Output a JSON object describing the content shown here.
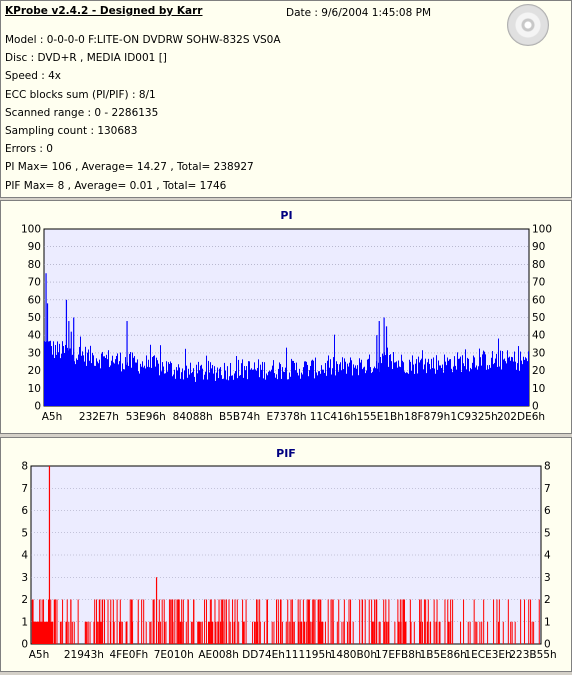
{
  "header": {
    "title": "KProbe v2.4.2 - Designed by Karr",
    "date": "Date : 9/6/2004 1:45:08 PM",
    "lines": [
      "Model : 0-0-0-0 F:LITE-ON DVDRW SOHW-832S  VS0A",
      "Disc : DVD+R , MEDIA ID001 []",
      "Speed : 4x",
      "ECC blocks sum (PI/PIF) : 8/1",
      "Scanned range : 0 - 2286135",
      "Sampling count : 130683",
      "Errors : 0",
      "PI Max= 106 , Average= 14.27 , Total= 238927",
      "PIF Max= 8 , Average= 0.01 , Total= 1746"
    ]
  },
  "chart_data": [
    {
      "type": "bar",
      "title": "PI",
      "ylim": [
        0,
        100
      ],
      "yticks": [
        0,
        10,
        20,
        30,
        40,
        50,
        60,
        70,
        80,
        90,
        100
      ],
      "xtick_labels": [
        "A5h",
        "232E7h",
        "53E96h",
        "84088h",
        "B5B74h",
        "E7378h",
        "11C416h",
        "155E1Bh",
        "18F879h",
        "1C9325h",
        "202DE6h"
      ],
      "color": "#0000ff",
      "profile_x": [
        0,
        0.01,
        0.02,
        0.04,
        0.06,
        0.1,
        0.15,
        0.2,
        0.25,
        0.3,
        0.35,
        0.4,
        0.5,
        0.6,
        0.65,
        0.68,
        0.7,
        0.72,
        0.76,
        0.8,
        0.9,
        1.0
      ],
      "profile_y": [
        33,
        32,
        30,
        29,
        28,
        26,
        24,
        22,
        20,
        17,
        18,
        19,
        19,
        20,
        21,
        22,
        24,
        23,
        22,
        22,
        24,
        24
      ],
      "spikes": [
        {
          "x": 0.003,
          "y": 75
        },
        {
          "x": 0.006,
          "y": 58
        },
        {
          "x": 0.045,
          "y": 60
        },
        {
          "x": 0.05,
          "y": 48
        },
        {
          "x": 0.06,
          "y": 50
        },
        {
          "x": 0.055,
          "y": 42
        },
        {
          "x": 0.17,
          "y": 48
        },
        {
          "x": 0.69,
          "y": 48
        },
        {
          "x": 0.7,
          "y": 50
        },
        {
          "x": 0.705,
          "y": 45
        },
        {
          "x": 0.685,
          "y": 40
        }
      ]
    },
    {
      "type": "bar",
      "title": "PIF",
      "ylim": [
        0,
        8
      ],
      "yticks": [
        0,
        1,
        2,
        3,
        4,
        5,
        6,
        7,
        8
      ],
      "xtick_labels": [
        "A5h",
        "21943h",
        "4FE0Fh",
        "7E010h",
        "AE008h",
        "DD74Eh",
        "111195h",
        "1480B0h",
        "17EFB8h",
        "1B5E86h",
        "1ECE3Eh",
        "223B55h"
      ],
      "color": "#ff0000",
      "spikes": [
        {
          "x": 0.035,
          "y": 8
        },
        {
          "x": 0.245,
          "y": 3
        }
      ]
    }
  ]
}
